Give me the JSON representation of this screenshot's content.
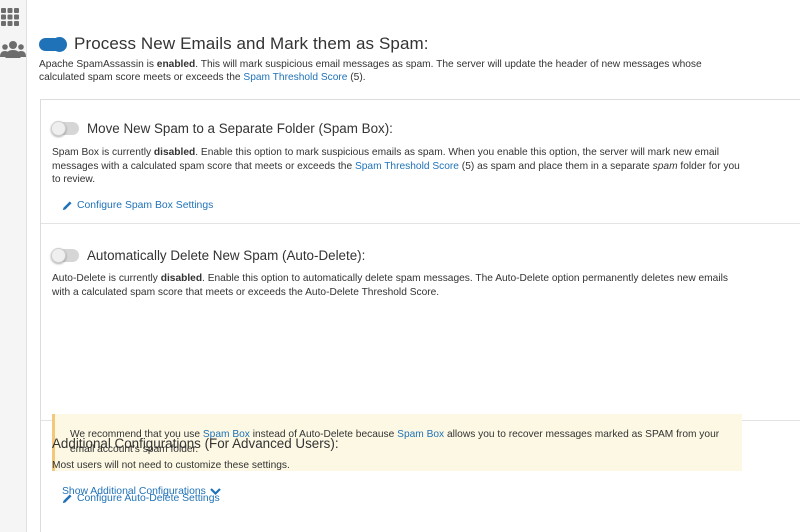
{
  "rail": {
    "apps_icon": "grid-apps-icon",
    "users_icon": "users-icon"
  },
  "process": {
    "title": "Process New Emails and Mark them as Spam:",
    "enabled": true,
    "desc_prefix": "Apache SpamAssassin is ",
    "desc_status": "enabled",
    "desc_middle": ". This will mark suspicious email messages as spam. The server will update the header of new messages whose calculated spam score meets or exceeds the ",
    "threshold_link": "Spam Threshold Score",
    "desc_suffix": " (5)."
  },
  "spam_box": {
    "title": "Move New Spam to a Separate Folder (Spam Box):",
    "enabled": false,
    "desc_prefix": "Spam Box is currently ",
    "desc_status": "disabled",
    "desc_middle": ". Enable this option to mark suspicious emails as spam. When you enable this option, the server will mark new email messages with a calculated spam score that meets or exceeds the ",
    "threshold_link": "Spam Threshold Score",
    "desc_after_link": " (5) as spam and place them in a separate ",
    "desc_italic": "spam",
    "desc_suffix": " folder for you to review.",
    "configure_label": "Configure Spam Box Settings"
  },
  "auto_delete": {
    "title": "Automatically Delete New Spam (Auto-Delete):",
    "enabled": false,
    "desc_prefix": "Auto-Delete is currently ",
    "desc_status": "disabled",
    "desc_suffix": ". Enable this option to automatically delete spam messages. The Auto-Delete option permanently deletes new emails with a calculated spam score that meets or exceeds the Auto-Delete Threshold Score.",
    "notice_prefix": "We recommend that you use ",
    "notice_link1": "Spam Box",
    "notice_middle": " instead of Auto-Delete because ",
    "notice_link2": "Spam Box",
    "notice_suffix": " allows you to recover messages marked as SPAM from your email account's spam folder.",
    "configure_label": "Configure Auto-Delete Settings"
  },
  "additional": {
    "title": "Additional Configurations (For Advanced Users):",
    "desc": "Most users will not need to customize these settings.",
    "show_label": "Show Additional Configurations"
  },
  "colors": {
    "accent": "#1f72b8",
    "toggle_off": "#d6d6d6",
    "notice_bg": "#fcf8e3",
    "notice_border": "#f3c87a"
  }
}
